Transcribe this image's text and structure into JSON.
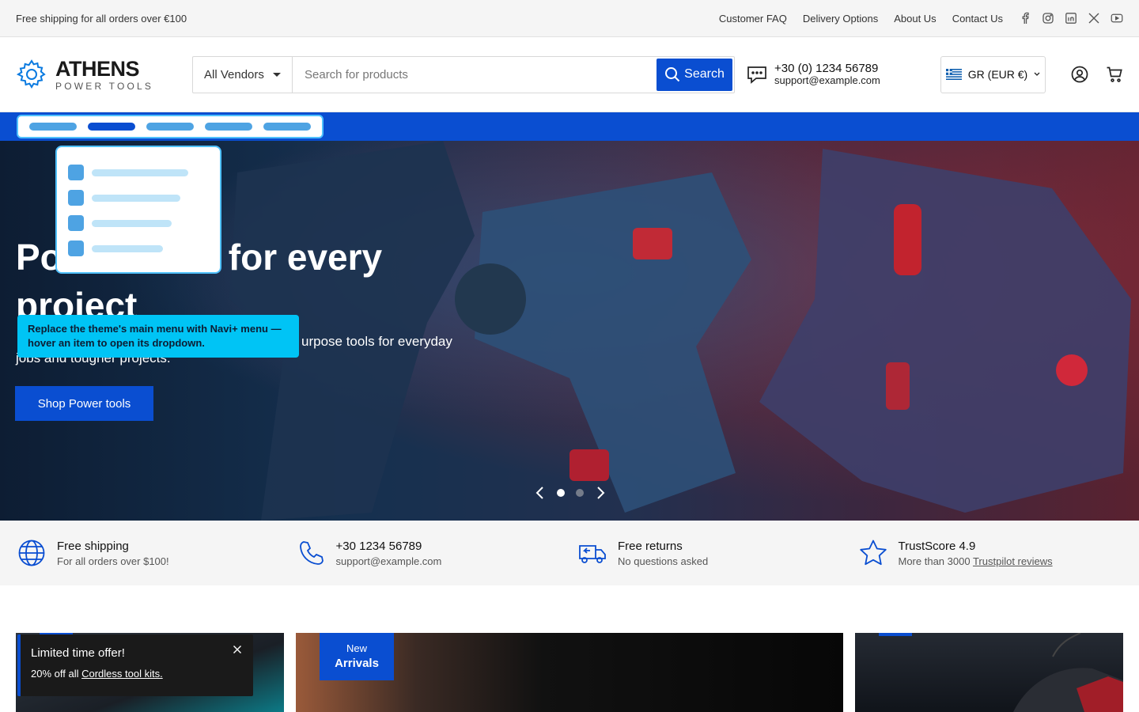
{
  "topbar": {
    "announcement": "Free shipping for all orders over €100",
    "links": [
      "Customer FAQ",
      "Delivery Options",
      "About Us",
      "Contact Us"
    ],
    "social_icons": [
      "facebook-icon",
      "instagram-icon",
      "linkedin-icon",
      "x-icon",
      "youtube-icon"
    ]
  },
  "header": {
    "logo_main": "ATHENS",
    "logo_sub": "POWER TOOLS",
    "vendor_select": "All Vendors",
    "search_placeholder": "Search for products",
    "search_button": "Search",
    "phone": "+30 (0) 1234 56789",
    "email": "support@example.com",
    "currency": "GR (EUR €)",
    "icons": [
      "account-icon",
      "cart-icon"
    ]
  },
  "hero": {
    "title": "Power tools for every project",
    "title_visible_right": "for every",
    "title_visible_left": "Po",
    "title_line2": "project",
    "description_visible": "urpose tools for everyday",
    "description_line2": "jobs and tougher projects.",
    "button": "Shop Power tools",
    "tooltip": "Replace the theme's main menu with Navi+ menu — hover an item to open its dropdown.",
    "slides": 2,
    "active_slide": 1
  },
  "features": [
    {
      "icon": "globe-icon",
      "title": "Free shipping",
      "sub": "For all orders over $100!"
    },
    {
      "icon": "phone-icon",
      "title": "+30 1234 56789",
      "sub": "support@example.com"
    },
    {
      "icon": "truck-return-icon",
      "title": "Free returns",
      "sub": "No questions asked"
    },
    {
      "icon": "star-icon",
      "title": "TrustScore 4.9",
      "sub_prefix": "More than 3000 ",
      "sub_link": "Trustpilot reviews"
    }
  ],
  "promos": {
    "badge_line1": "New",
    "badge_line2": "Arrivals"
  },
  "toast": {
    "title": "Limited time offer!",
    "body_prefix": "20% off all ",
    "body_link": "Cordless tool kits."
  },
  "colors": {
    "accent": "#0a4ed1",
    "highlight": "#00c4f5"
  }
}
